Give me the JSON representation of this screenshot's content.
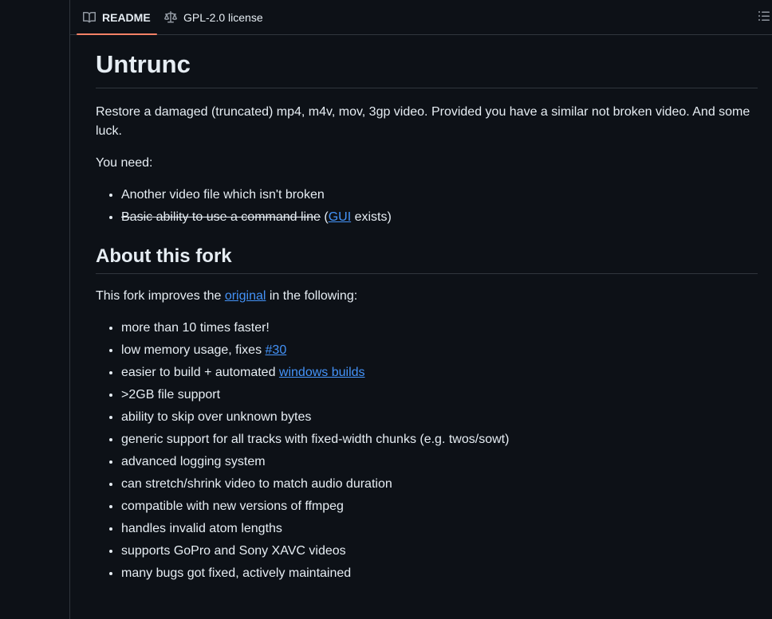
{
  "tabs": {
    "readme": "README",
    "license": "GPL-2.0 license"
  },
  "readme": {
    "title": "Untrunc",
    "intro": "Restore a damaged (truncated) mp4, m4v, mov, 3gp video. Provided you have a similar not broken video. And some luck.",
    "you_need": "You need:",
    "need_item_1": "Another video file which isn't broken",
    "need_item_2_strike": "Basic ability to use a command line",
    "need_item_2_open": " (",
    "need_item_2_link": "GUI",
    "need_item_2_close": " exists)",
    "fork_heading": "About this fork",
    "fork_intro_pre": "This fork improves the ",
    "fork_intro_link": "original",
    "fork_intro_post": " in the following:",
    "features": {
      "f1": "more than 10 times faster!",
      "f2_pre": "low memory usage, fixes ",
      "f2_link": "#30",
      "f3_pre": "easier to build + automated ",
      "f3_link": "windows builds",
      "f4": ">2GB file support",
      "f5": "ability to skip over unknown bytes",
      "f6": "generic support for all tracks with fixed-width chunks (e.g. twos/sowt)",
      "f7": "advanced logging system",
      "f8": "can stretch/shrink video to match audio duration",
      "f9": "compatible with new versions of ffmpeg",
      "f10": "handles invalid atom lengths",
      "f11": "supports GoPro and Sony XAVC videos",
      "f12": "many bugs got fixed, actively maintained"
    }
  },
  "colors": {
    "background": "#0d1117",
    "text": "#e6edf3",
    "link": "#4493f8",
    "border": "#30363d",
    "active_tab_underline": "#f78166"
  },
  "icons": {
    "readme_tab": "book-icon",
    "license_tab": "law-scale-icon",
    "outline": "list-outline-icon"
  }
}
